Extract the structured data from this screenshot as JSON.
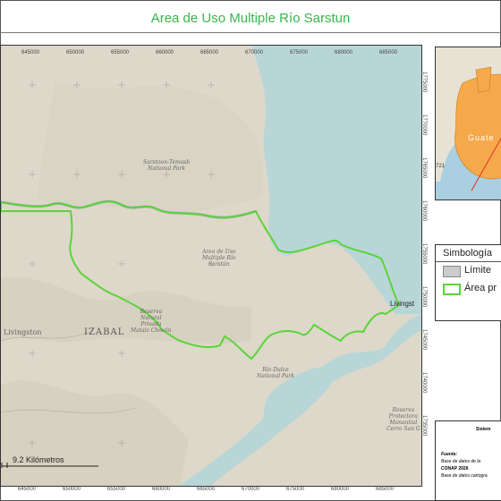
{
  "title": "Area de Uso Multiple Río Sarstun",
  "map": {
    "top_coords": [
      "645000",
      "650000",
      "655000",
      "660000",
      "665000",
      "670000",
      "675000",
      "680000",
      "685000"
    ],
    "bottom_coords": [
      "645000",
      "650000",
      "655000",
      "660000",
      "665000",
      "670000",
      "675000",
      "680000",
      "685000"
    ],
    "right_coords": [
      "1775000",
      "1770000",
      "1765000",
      "1760000",
      "1755000",
      "1750000",
      "1745000",
      "1740000",
      "1735000"
    ],
    "labels": {
      "park_north_1": "Sarstoon-Temash",
      "park_north_2": "National Park",
      "area_1": "Area de Uso",
      "area_2": "Multiple Río",
      "area_3": "Sarstún",
      "reserve_1": "Reserva",
      "reserve_2": "Natural",
      "reserve_3": "Privada",
      "reserve_4": "Mataiz Chocón",
      "livingston_region": "Livingston",
      "izabal": "IZABAL",
      "livingston_town": "Livingst",
      "rio_dulce_1": "Río Dulce",
      "rio_dulce_2": "National Park",
      "protectora_1": "Reserva",
      "protectora_2": "Protectora",
      "protectora_3": "Manantial",
      "protectora_4": "Cerro San G"
    },
    "scale_label": "9.2 Kilómetros"
  },
  "inset": {
    "label": "Guate",
    "marker": "721"
  },
  "legend": {
    "title": "Simbología",
    "items": [
      {
        "label": "Límite",
        "color": "#cccccc",
        "border": "#888888"
      },
      {
        "label": "Área pr",
        "color": "#ffffff",
        "border": "#5bd43a"
      }
    ]
  },
  "info": {
    "heading": "Sistem",
    "lines": [
      "Fuente:",
      "Base de datos de la",
      "CONAP 2026",
      "Base de datos cartogra"
    ]
  },
  "colors": {
    "title": "#39b54a",
    "boundary": "#5bd43a",
    "water": "#b8d6d8",
    "land": "#ddd8c9"
  }
}
